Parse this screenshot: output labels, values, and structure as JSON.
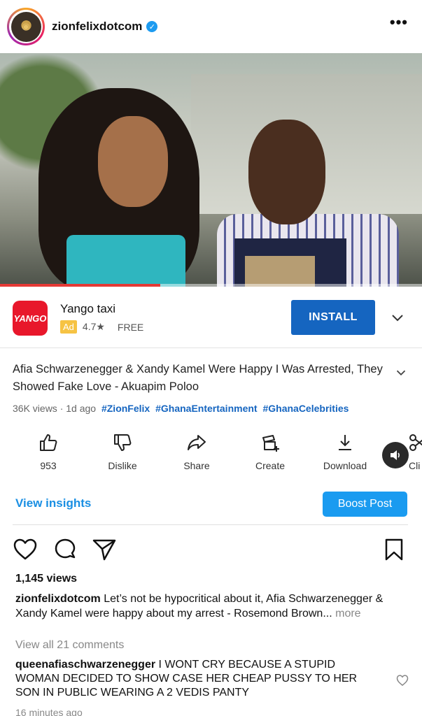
{
  "header": {
    "username": "zionfelixdotcom",
    "verified": true
  },
  "video": {
    "progress_fraction": 0.38
  },
  "ad": {
    "logo_text": "YANGO",
    "title": "Yango taxi",
    "badge": "Ad",
    "rating": "4.7★",
    "price": "FREE",
    "install_label": "INSTALL",
    "brand_color": "#e8172b",
    "button_color": "#1565c0"
  },
  "video_info": {
    "title": "Afia Schwarzenegger & Xandy Kamel Were Happy I Was Arrested, They Showed Fake Love - Akuapim Poloo",
    "meta": "36K views · 1d ago",
    "hashtags": [
      "#ZionFelix",
      "#GhanaEntertainment",
      "#GhanaCelebrities"
    ]
  },
  "actions": [
    {
      "label": "953",
      "icon": "thumbs-up-icon"
    },
    {
      "label": "Dislike",
      "icon": "thumbs-down-icon"
    },
    {
      "label": "Share",
      "icon": "share-icon"
    },
    {
      "label": "Create",
      "icon": "create-icon"
    },
    {
      "label": "Download",
      "icon": "download-icon"
    },
    {
      "label": "Cli",
      "icon": "clip-icon"
    }
  ],
  "insights": {
    "view_insights": "View insights",
    "boost_post": "Boost Post",
    "accent": "#1a9bf0"
  },
  "post": {
    "views": "1,145 views",
    "caption_user": "zionfelixdotcom",
    "caption_text": "Let’s not be hypocritical about it, Afia Schwarzenegger & Xandy Kamel were happy about my arrest - Rosemond Brown...",
    "more": "more",
    "view_all_comments": "View all 21 comments",
    "comment_user": "queenafiaschwarzenegger",
    "comment_text": "I WONT CRY BECAUSE A STUPID WOMAN DECIDED TO SHOW CASE HER CHEAP PUSSY TO HER SON IN  PUBLIC WEARING A 2 VEDIS PANTY",
    "time_ago": "16 minutes ago"
  }
}
